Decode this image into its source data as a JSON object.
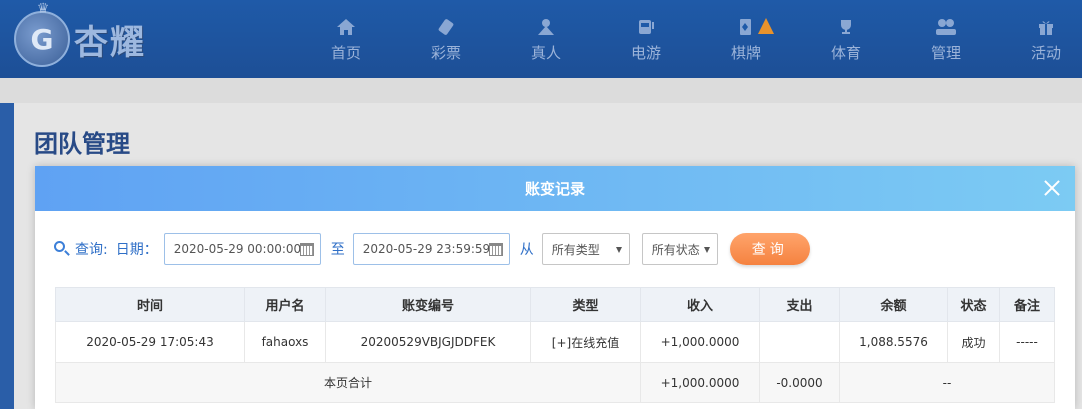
{
  "brand": {
    "name": "杏耀",
    "mark": "G"
  },
  "nav": [
    {
      "label": "首页",
      "icon": "home-icon"
    },
    {
      "label": "彩票",
      "icon": "lottery-icon"
    },
    {
      "label": "真人",
      "icon": "live-dealer-icon"
    },
    {
      "label": "电游",
      "icon": "slot-machine-icon"
    },
    {
      "label": "棋牌",
      "icon": "card-game-icon"
    },
    {
      "label": "体育",
      "icon": "trophy-icon"
    },
    {
      "label": "管理",
      "icon": "users-icon"
    },
    {
      "label": "活动",
      "icon": "gift-icon"
    }
  ],
  "page": {
    "title": "团队管理"
  },
  "modal": {
    "title": "账变记录",
    "query": {
      "label": "查询:",
      "date_label": "日期：",
      "start_date": "2020-05-29 00:00:00",
      "to_label": "至",
      "end_date": "2020-05-29 23:59:59",
      "from_label": "从",
      "type_select": "所有类型",
      "status_select": "所有状态",
      "button": "查询"
    },
    "table": {
      "headers": [
        "时间",
        "用户名",
        "账变编号",
        "类型",
        "收入",
        "支出",
        "余额",
        "状态",
        "备注"
      ],
      "rows": [
        [
          "2020-05-29 17:05:43",
          "fahaoxs",
          "20200529VBJGJDDFEK",
          "[+]在线充值",
          "+1,000.0000",
          "",
          "1,088.5576",
          "成功",
          "-----"
        ]
      ],
      "total": {
        "label": "本页合计",
        "income": "+1,000.0000",
        "expense": "-0.0000",
        "balance": "--"
      }
    }
  }
}
